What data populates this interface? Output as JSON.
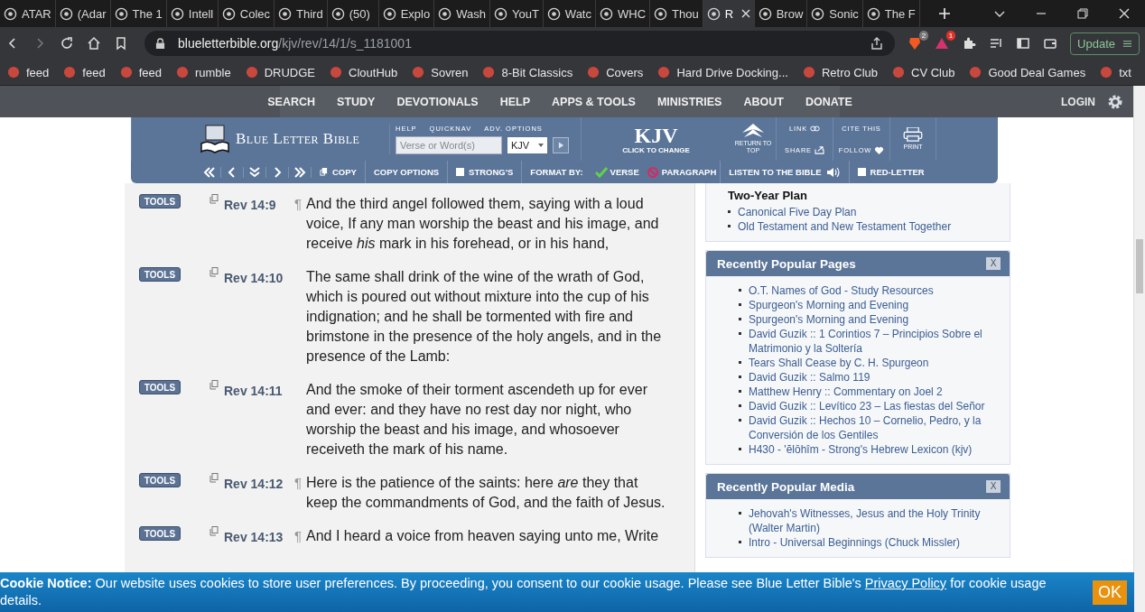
{
  "browser": {
    "tabs": [
      {
        "title": "ATAR",
        "selected": false
      },
      {
        "title": "(Adar",
        "selected": false
      },
      {
        "title": "The 1",
        "selected": false
      },
      {
        "title": "Intell",
        "selected": false
      },
      {
        "title": "Colec",
        "selected": false
      },
      {
        "title": "Third",
        "selected": false
      },
      {
        "title": "(50)",
        "selected": false
      },
      {
        "title": "Explo",
        "selected": false
      },
      {
        "title": "Wash",
        "selected": false
      },
      {
        "title": "YouT",
        "selected": false
      },
      {
        "title": "Watc",
        "selected": false
      },
      {
        "title": "WHC",
        "selected": false
      },
      {
        "title": "Thou",
        "selected": false
      },
      {
        "title": "R",
        "selected": true
      },
      {
        "title": "Brow",
        "selected": false
      },
      {
        "title": "Sonic",
        "selected": false
      },
      {
        "title": "The F",
        "selected": false
      }
    ],
    "address": {
      "host": "blueletterbible.org",
      "path": "/kjv/rev/14/1/s_1181001"
    },
    "badges": [
      "2",
      "1"
    ],
    "update": "Update",
    "bookmarks": [
      "feed",
      "feed",
      "feed",
      "rumble",
      "DRUDGE",
      "CloutHub",
      "Sovren",
      "8-Bit Classics",
      "Covers",
      "Hard Drive Docking...",
      "Retro Club",
      "CV Club",
      "Good Deal Games",
      "txt"
    ]
  },
  "site_nav": {
    "items": [
      "SEARCH",
      "STUDY",
      "DEVOTIONALS",
      "HELP",
      "APPS & TOOLS",
      "MINISTRIES",
      "ABOUT",
      "DONATE"
    ],
    "login": "LOGIN"
  },
  "header": {
    "logo": "Blue Letter Bible",
    "search_labels": [
      "HELP",
      "QUICKNAV",
      "ADV. OPTIONS"
    ],
    "search": {
      "placeholder": "Verse or Word(s)"
    },
    "version_select": "KJV",
    "version": "KJV",
    "version_hint": "CLICK TO CHANGE",
    "return_top": "RETURN TO TOP",
    "link": "LINK",
    "share": "SHARE",
    "cite": "CITE THIS",
    "follow": "FOLLOW",
    "print": "PRINT"
  },
  "toolbar": {
    "copy": "COPY",
    "copy_options": "COPY OPTIONS",
    "strongs": {
      "label": "STRONG'S",
      "checked": false
    },
    "format_label": "FORMAT BY:",
    "formats": [
      {
        "label": "VERSE",
        "selected": true
      },
      {
        "label": "PARAGRAPH",
        "selected": false
      }
    ],
    "listen": "LISTEN TO THE BIBLE",
    "red_letter": {
      "label": "RED-LETTER",
      "checked": false
    }
  },
  "verses": [
    {
      "tools": "TOOLS",
      "ref": "Rev 14:9",
      "mark": "¶",
      "text": "And the third angel followed them, saying with a loud voice, If any man worship the beast and his image, and receive *his* mark in his forehead, or in his hand,"
    },
    {
      "tools": "TOOLS",
      "ref": "Rev 14:10",
      "text": "The same shall drink of the wine of the wrath of God, which is poured out without mixture into the cup of his indignation; and he shall be tormented with fire and brimstone in the presence of the holy angels, and in the presence of the Lamb:"
    },
    {
      "tools": "TOOLS",
      "ref": "Rev 14:11",
      "text": "And the smoke of their torment ascendeth up for ever and ever: and they have no rest day nor night, who worship the beast and his image, and whosoever receiveth the mark of his name."
    },
    {
      "tools": "TOOLS",
      "ref": "Rev 14:12",
      "mark": "¶",
      "text": "Here is the patience of the saints: here *are* they that keep the commandments of God, and the faith of Jesus."
    },
    {
      "tools": "TOOLS",
      "ref": "Rev 14:13",
      "mark": "¶",
      "text": "And I heard a voice from heaven saying unto me, Write"
    }
  ],
  "sidebar": {
    "plan": {
      "title": "Two-Year Plan",
      "links": [
        "Canonical Five Day Plan",
        "Old Testament and New Testament Together"
      ]
    },
    "panels": [
      {
        "title": "Recently Popular Pages",
        "close": "X",
        "links": [
          "O.T. Names of God - Study Resources",
          "Spurgeon's Morning and Evening",
          "Spurgeon's Morning and Evening",
          "David Guzik :: 1 Corintios 7 – Principios Sobre el Matrimonio y la Soltería",
          "Tears Shall Cease by C. H. Spurgeon",
          "David Guzik :: Salmo 119",
          "Matthew Henry :: Commentary on Joel 2",
          "David Guzik :: Levítico 23 – Las fiestas del Señor",
          "David Guzik :: Hechos 10 – Cornelio, Pedro, y la Conversión de los Gentiles",
          "H430 - 'ĕlōhîm - Strong's Hebrew Lexicon (kjv)"
        ]
      },
      {
        "title": "Recently Popular Media",
        "close": "X",
        "links": [
          "Jehovah's Witnesses, Jesus and the Holy Trinity (Walter Martin)",
          "Intro - Universal Beginnings (Chuck Missler)"
        ]
      }
    ]
  },
  "cookie": {
    "text": "**Cookie Notice:** Our website uses cookies to store user preferences. By proceeding, you consent to our cookie usage. Please see Blue Letter Bible's",
    "link": "Privacy Policy",
    "after": "for cookie usage details.",
    "button": "OK"
  }
}
